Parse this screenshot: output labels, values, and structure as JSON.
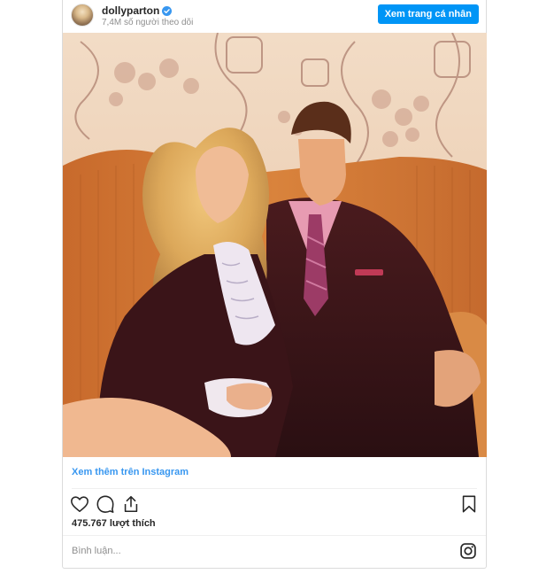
{
  "header": {
    "username": "dollyparton",
    "followers": "7,4M số người theo dõi",
    "view_profile_label": "Xem trang cá nhân"
  },
  "post": {
    "more_link": "Xem thêm trên Instagram",
    "likes": "475.767 lượt thích",
    "comment_placeholder": "Bình luận..."
  },
  "icons": {
    "avatar": "avatar",
    "verified": "verified-badge-icon",
    "like": "heart-icon",
    "comment": "comment-bubble-icon",
    "share": "share-icon",
    "save": "bookmark-icon",
    "instagram": "instagram-logo-icon"
  },
  "colors": {
    "accent": "#0095f6",
    "link": "#3897f0",
    "muted": "#8e8e8e"
  }
}
